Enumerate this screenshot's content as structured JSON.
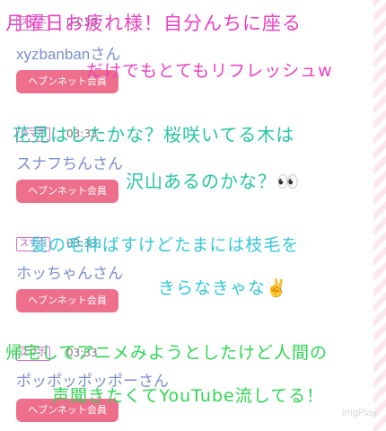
{
  "posts": [
    {
      "badge": "スマホ",
      "time": "03:33",
      "username": "xyzbanbanさん",
      "member_label": "ヘブンネット会員",
      "caption_line1": "月曜日お疲れ様！自分んちに座る",
      "caption_line2": "だけでもとてもリフレッシュw"
    },
    {
      "badge": "スマホ",
      "time": "03:33",
      "username": "スナフちんさん",
      "member_label": "ヘブンネット会員",
      "caption_line1": "花見はしたかな？桜咲いてる木は",
      "caption_line2": "沢山あるのかな？👀"
    },
    {
      "badge": "スマホ",
      "time": "03:33",
      "username": "ホッちゃんさん",
      "member_label": "ヘブンネット会員",
      "caption_line1": "髪の毛伸ばすけどたまには枝毛を",
      "caption_line2": "きらなきゃな✌️"
    },
    {
      "badge": "スマホ",
      "time": "03:33",
      "username": "ポッポッポッポーさん",
      "member_label": "ヘブンネット会員",
      "caption_line1": "帰宅してアニメみようとしたけど人間の",
      "caption_line2": "声聞きたくてYouTube流してる！"
    }
  ],
  "watermark": "imgPlay"
}
